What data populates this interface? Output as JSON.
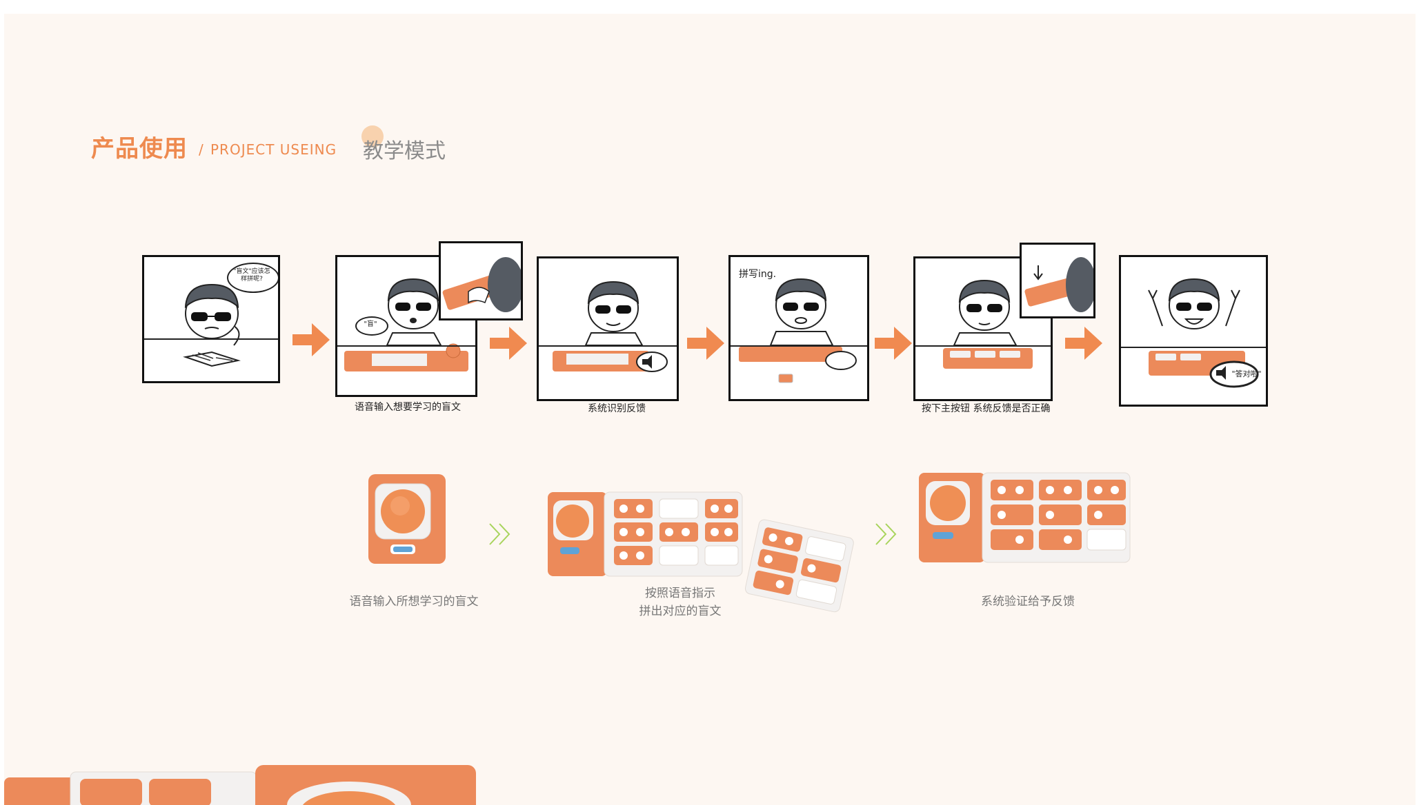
{
  "header": {
    "title_cn": "产品使用",
    "separator": "/",
    "title_en": "PROJECT USEING",
    "mode_label": "教学模式"
  },
  "comic": {
    "panels": [
      {
        "speech": "\"盲文\"应该怎样拼呢?",
        "caption": ""
      },
      {
        "speech": "\"盲\"",
        "caption": "语音输入想要学习的盲文"
      },
      {
        "speech": "",
        "caption": "系统识别反馈"
      },
      {
        "speech": "拼写ing.",
        "caption": ""
      },
      {
        "speech": "",
        "caption": "按下主按钮 系统反馈是否正确"
      },
      {
        "speech": "\"答对啦\"",
        "caption": ""
      }
    ]
  },
  "steps": [
    {
      "caption": "语音输入所想学习的盲文"
    },
    {
      "caption_line1": "按照语音指示",
      "caption_line2": "拼出对应的盲文"
    },
    {
      "caption": "系统验证给予反馈"
    }
  ],
  "colors": {
    "accent": "#ee8a4f",
    "arrow": "#f08a50",
    "chevron": "#a8d45c",
    "device_orange": "#ec8a5a",
    "device_white": "#f3f1f0",
    "background": "#fdf7f2"
  }
}
